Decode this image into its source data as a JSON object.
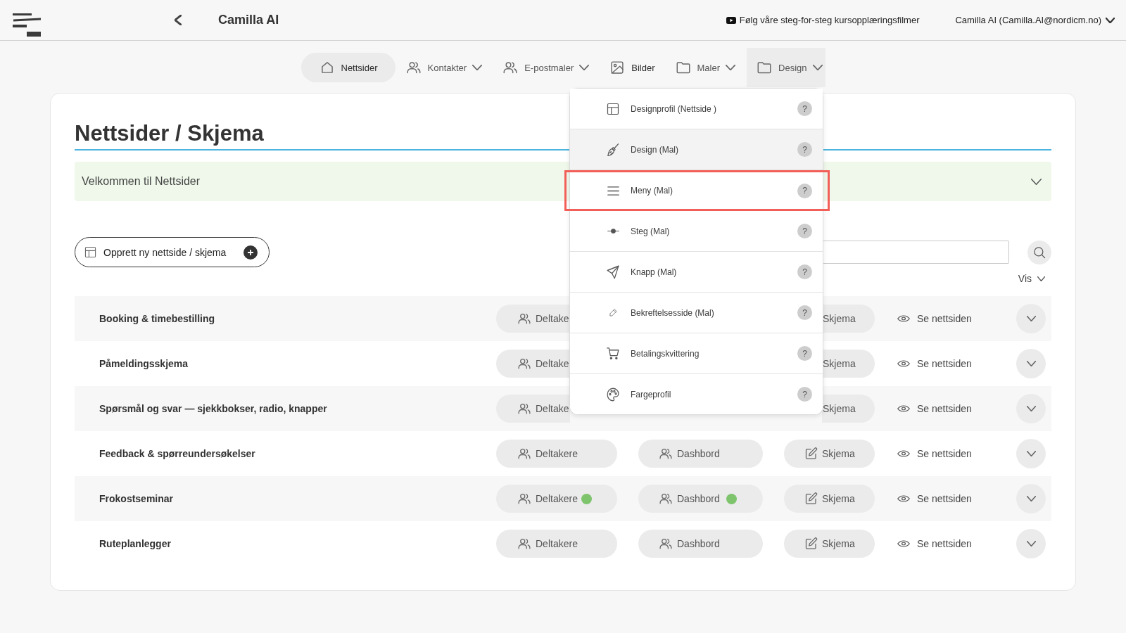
{
  "top_bar": {
    "title": "Camilla AI",
    "tutorial_link": "Følg våre steg-for-steg kursopplæringsfilmer",
    "user": "Camilla AI (Camilla.AI@nordicm.no)"
  },
  "nav": [
    {
      "label": "Nettsider",
      "kind": "link",
      "selected": true,
      "expanded": false
    },
    {
      "label": "Kontakter",
      "kind": "dropdown",
      "selected": false,
      "expanded": false
    },
    {
      "label": "E-postmaler",
      "kind": "dropdown",
      "selected": false,
      "expanded": false
    },
    {
      "label": "Bilder",
      "kind": "link",
      "selected": false,
      "expanded": false
    },
    {
      "label": "Maler",
      "kind": "dropdown",
      "selected": false,
      "expanded": false
    },
    {
      "label": "Design",
      "kind": "dropdown",
      "selected": false,
      "expanded": true
    }
  ],
  "design_menu": {
    "items": [
      {
        "label": "Designprofil (Nettside )",
        "help": "?",
        "hovered": false,
        "highlighted": false
      },
      {
        "label": "Design (Mal)",
        "help": "?",
        "hovered": true,
        "highlighted": false
      },
      {
        "label": "Meny (Mal)",
        "help": "?",
        "hovered": false,
        "highlighted": true
      },
      {
        "label": "Steg (Mal)",
        "help": "?",
        "hovered": false,
        "highlighted": false
      },
      {
        "label": "Knapp (Mal)",
        "help": "?",
        "hovered": false,
        "highlighted": false
      },
      {
        "label": "Bekreftelsesside (Mal)",
        "help": "?",
        "hovered": false,
        "highlighted": false
      },
      {
        "label": "Betalingskvittering",
        "help": "?",
        "hovered": false,
        "highlighted": false
      },
      {
        "label": "Fargeprofil",
        "help": "?",
        "hovered": false,
        "highlighted": false
      }
    ]
  },
  "page": {
    "heading": "Nettsider / Skjema",
    "welcome": {
      "text": "Velkommen til Nettsider",
      "expanded": false
    },
    "create_button": "Opprett ny nettside / skjema",
    "view_menu": "Vis"
  },
  "rows": [
    {
      "name": "Booking & timebestilling",
      "covered": true,
      "participants": {
        "label": "Deltake"
      },
      "form": {
        "label": "Skjema"
      },
      "view": "Se nettsiden"
    },
    {
      "name": "Påmeldingsskjema",
      "covered": true,
      "participants": {
        "label": "Deltake"
      },
      "form": {
        "label": "Skjema"
      },
      "view": "Se nettsiden"
    },
    {
      "name": "Spørsmål og svar — sjekkbokser, radio, knapper",
      "covered": true,
      "participants": {
        "label": "Deltake"
      },
      "form": {
        "label": "Skjema"
      },
      "view": "Se nettsiden"
    },
    {
      "name": "Feedback & spørreundersøkelser",
      "covered": false,
      "participants": {
        "label": "Deltakere",
        "indicator": false
      },
      "dashboard": {
        "label": "Dashbord",
        "indicator": false
      },
      "form": {
        "label": "Skjema"
      },
      "view": "Se nettsiden"
    },
    {
      "name": "Frokostseminar",
      "covered": false,
      "participants": {
        "label": "Deltakere",
        "indicator": true
      },
      "dashboard": {
        "label": "Dashbord",
        "indicator": true
      },
      "form": {
        "label": "Skjema"
      },
      "view": "Se nettsiden"
    },
    {
      "name": "Ruteplanlegger",
      "covered": false,
      "participants": {
        "label": "Deltakere",
        "indicator": false
      },
      "dashboard": {
        "label": "Dashbord",
        "indicator": false
      },
      "form": {
        "label": "Skjema"
      },
      "view": "Se nettsiden"
    }
  ]
}
